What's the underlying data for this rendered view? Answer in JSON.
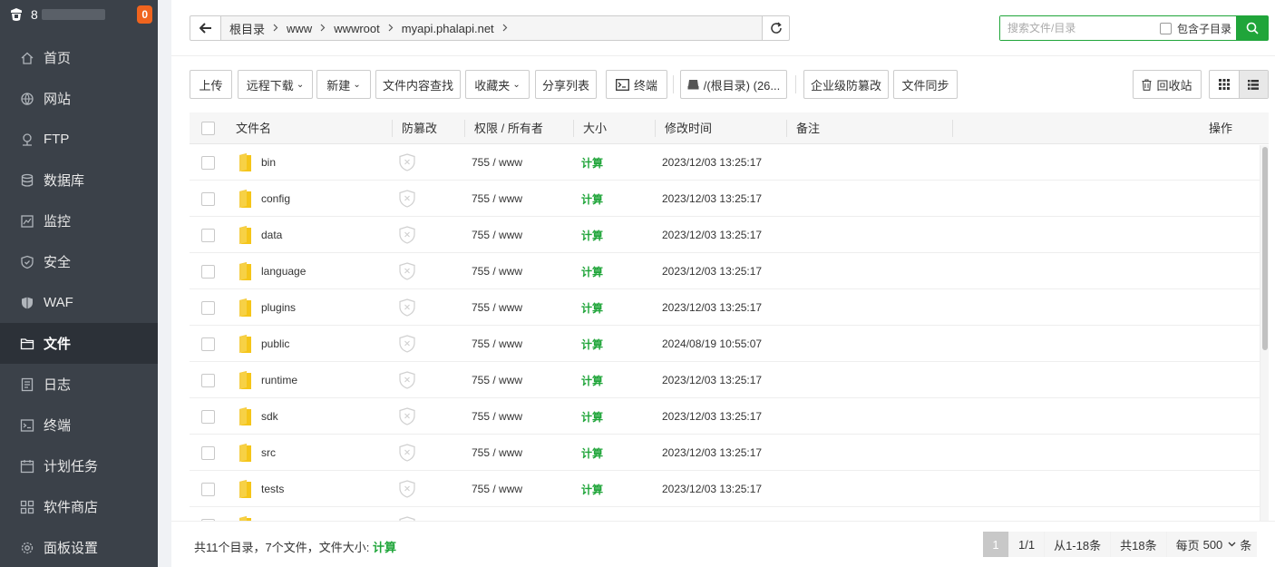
{
  "sidebar": {
    "logo_prefix": "8",
    "badge": "0",
    "items": [
      {
        "label": "首页",
        "icon": "home-icon"
      },
      {
        "label": "网站",
        "icon": "globe-icon"
      },
      {
        "label": "FTP",
        "icon": "ftp-icon"
      },
      {
        "label": "数据库",
        "icon": "database-icon"
      },
      {
        "label": "监控",
        "icon": "monitor-icon"
      },
      {
        "label": "安全",
        "icon": "shield-icon"
      },
      {
        "label": "WAF",
        "icon": "waf-shield-icon"
      },
      {
        "label": "文件",
        "icon": "folder-icon",
        "active": true
      },
      {
        "label": "日志",
        "icon": "log-icon"
      },
      {
        "label": "终端",
        "icon": "terminal-icon"
      },
      {
        "label": "计划任务",
        "icon": "calendar-icon"
      },
      {
        "label": "软件商店",
        "icon": "apps-icon"
      },
      {
        "label": "面板设置",
        "icon": "gear-icon"
      }
    ]
  },
  "path": {
    "segments": [
      "根目录",
      "www",
      "wwwroot",
      "myapi.phalapi.net"
    ]
  },
  "search": {
    "placeholder": "搜索文件/目录",
    "include_subdir": "包含子目录"
  },
  "toolbar": {
    "upload": "上传",
    "remote_download": "远程下载",
    "new": "新建",
    "content_search": "文件内容查找",
    "favorites": "收藏夹",
    "share_list": "分享列表",
    "terminal": "终端",
    "disk": "/(根目录) (26...",
    "tamper_proof": "企业级防篡改",
    "file_sync": "文件同步",
    "recycle_bin": "回收站"
  },
  "table": {
    "headers": {
      "name": "文件名",
      "tamper": "防篡改",
      "perm": "权限 / 所有者",
      "size": "大小",
      "mtime": "修改时间",
      "note": "备注",
      "ops": "操作"
    },
    "rows": [
      {
        "name": "bin",
        "perm": "755 / www",
        "size": "计算",
        "mtime": "2023/12/03 13:25:17"
      },
      {
        "name": "config",
        "perm": "755 / www",
        "size": "计算",
        "mtime": "2023/12/03 13:25:17"
      },
      {
        "name": "data",
        "perm": "755 / www",
        "size": "计算",
        "mtime": "2023/12/03 13:25:17"
      },
      {
        "name": "language",
        "perm": "755 / www",
        "size": "计算",
        "mtime": "2023/12/03 13:25:17"
      },
      {
        "name": "plugins",
        "perm": "755 / www",
        "size": "计算",
        "mtime": "2023/12/03 13:25:17"
      },
      {
        "name": "public",
        "perm": "755 / www",
        "size": "计算",
        "mtime": "2024/08/19 10:55:07"
      },
      {
        "name": "runtime",
        "perm": "755 / www",
        "size": "计算",
        "mtime": "2023/12/03 13:25:17"
      },
      {
        "name": "sdk",
        "perm": "755 / www",
        "size": "计算",
        "mtime": "2023/12/03 13:25:17"
      },
      {
        "name": "src",
        "perm": "755 / www",
        "size": "计算",
        "mtime": "2023/12/03 13:25:17"
      },
      {
        "name": "tests",
        "perm": "755 / www",
        "size": "计算",
        "mtime": "2023/12/03 13:25:17"
      }
    ]
  },
  "footer": {
    "summary": "共11个目录，7个文件，文件大小:",
    "summary_calc": "计算",
    "page_current": "1",
    "page_total": "1/1",
    "range": "从1-18条",
    "total": "共18条",
    "per_page_prefix": "每页",
    "per_page_value": "500",
    "per_page_suffix": "条"
  },
  "colors": {
    "accent": "#20a53a",
    "sidebar_bg": "#3b4149",
    "badge": "#f0641e",
    "folder": "#f5c518"
  }
}
